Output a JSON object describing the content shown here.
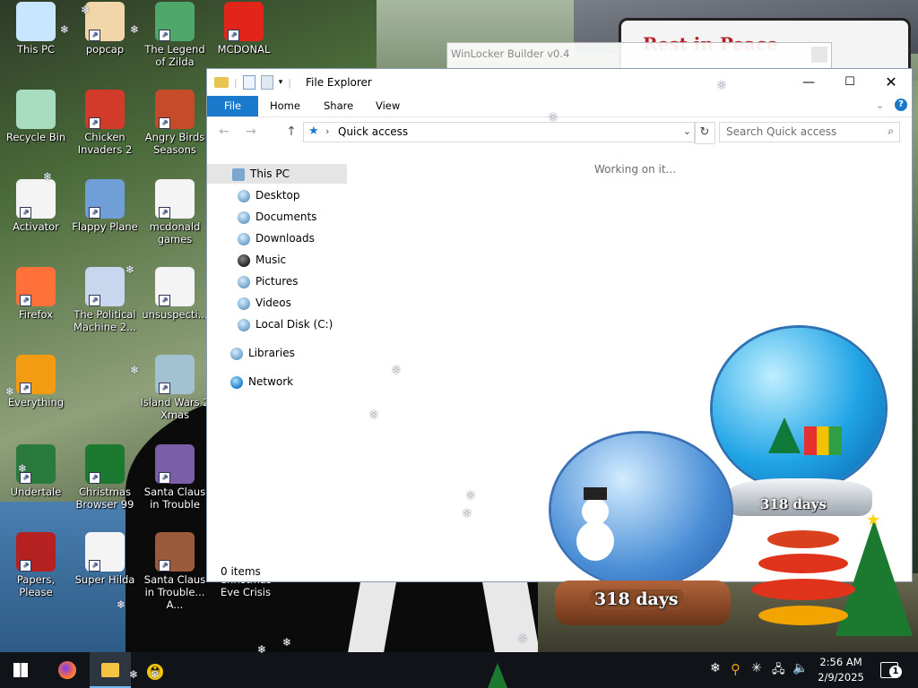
{
  "desktop_icons": [
    {
      "label": "This PC",
      "icon": "computer-icon"
    },
    {
      "label": "popcap",
      "icon": "folder-icon"
    },
    {
      "label": "The Legend of Zilda",
      "icon": "game-icon"
    },
    {
      "label": "MCDONAL",
      "icon": "mcdonalds-icon"
    },
    {
      "label": "Recycle Bin",
      "icon": "recycle-bin-icon"
    },
    {
      "label": "Chicken Invaders 2",
      "icon": "chicken-icon"
    },
    {
      "label": "Angry Birds Seasons",
      "icon": "angry-birds-icon"
    },
    {
      "label": "Activator",
      "icon": "file-icon"
    },
    {
      "label": "Flappy Plane",
      "icon": "game-icon"
    },
    {
      "label": "mcdonald games",
      "icon": "file-icon"
    },
    {
      "label": "Firefox",
      "icon": "firefox-icon"
    },
    {
      "label": "The Political Machine 2...",
      "icon": "game-icon"
    },
    {
      "label": "unsuspecti...",
      "icon": "file-icon"
    },
    {
      "label": "Everything",
      "icon": "search-icon"
    },
    {
      "label": "Island Wars 2 Xmas",
      "icon": "game-icon"
    },
    {
      "label": "Undertale",
      "icon": "undertale-icon"
    },
    {
      "label": "Christmas Browser 99",
      "icon": "christmas-tree-icon"
    },
    {
      "label": "Santa Claus in Trouble",
      "icon": "santa-icon"
    },
    {
      "label": "Papers, Please",
      "icon": "papers-please-icon"
    },
    {
      "label": "Super Hilda",
      "icon": "game-icon"
    },
    {
      "label": "Santa Claus in Trouble... A...",
      "icon": "santa-icon"
    },
    {
      "label": "Christmas Eve Crisis",
      "icon": "game-icon"
    }
  ],
  "winlocker": {
    "title": "WinLocker Builder v0.4"
  },
  "explorer": {
    "title": "File Explorer",
    "tabs": [
      "File",
      "Home",
      "Share",
      "View"
    ],
    "address": "Quick access",
    "search_placeholder": "Search Quick access",
    "working_text": "Working on it...",
    "status": "0 items",
    "nav": [
      {
        "label": "This PC",
        "selected": true
      },
      {
        "label": "Desktop"
      },
      {
        "label": "Documents"
      },
      {
        "label": "Downloads"
      },
      {
        "label": "Music"
      },
      {
        "label": "Pictures"
      },
      {
        "label": "Videos"
      },
      {
        "label": "Local Disk (C:)"
      },
      {
        "label": "Libraries"
      },
      {
        "label": "Network"
      }
    ]
  },
  "widgets": {
    "globe_small": "318 days",
    "globe_large": "318 days",
    "banner": "Rest in Peace"
  },
  "taskbar": {
    "time": "2:56 AM",
    "date": "2/9/2025",
    "notifications": "1"
  },
  "colors": {
    "accent": "#1979ca",
    "taskbar": "#101418"
  }
}
